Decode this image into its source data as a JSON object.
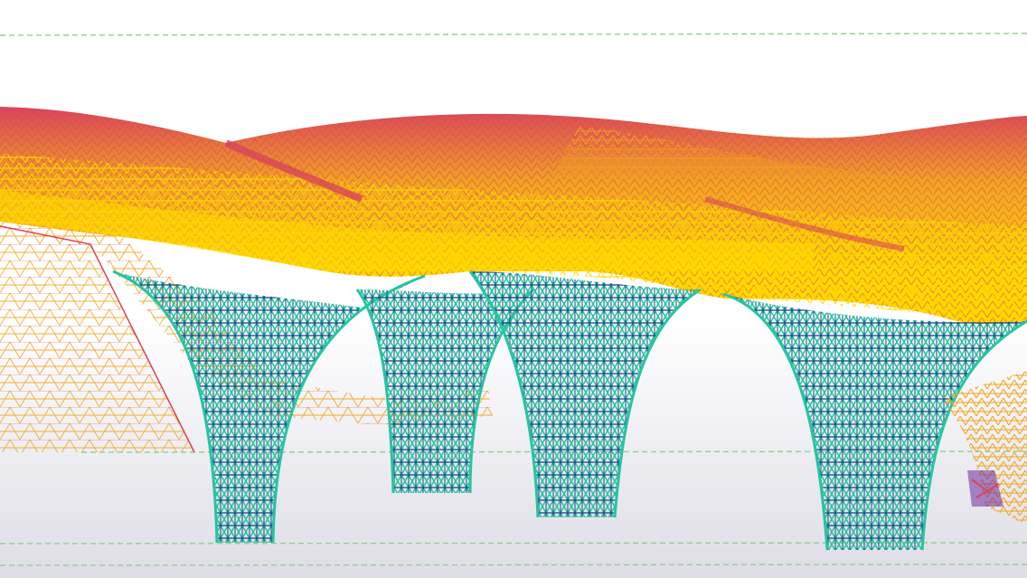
{
  "scene": {
    "subject": "3d-structural-model-viewport",
    "colors": {
      "background_top": "#ffffff",
      "background_bottom": "#dedde6",
      "grid_line": "#8fd08f",
      "roof_red": "#d8445a",
      "roof_orange": "#f3a521",
      "roof_yellow": "#ffd800",
      "column_teal": "#26c4a0",
      "column_navy": "#1f3f86",
      "mesh_purple": "#6a2aa0"
    },
    "reference_lines": 4,
    "columns": 4
  }
}
